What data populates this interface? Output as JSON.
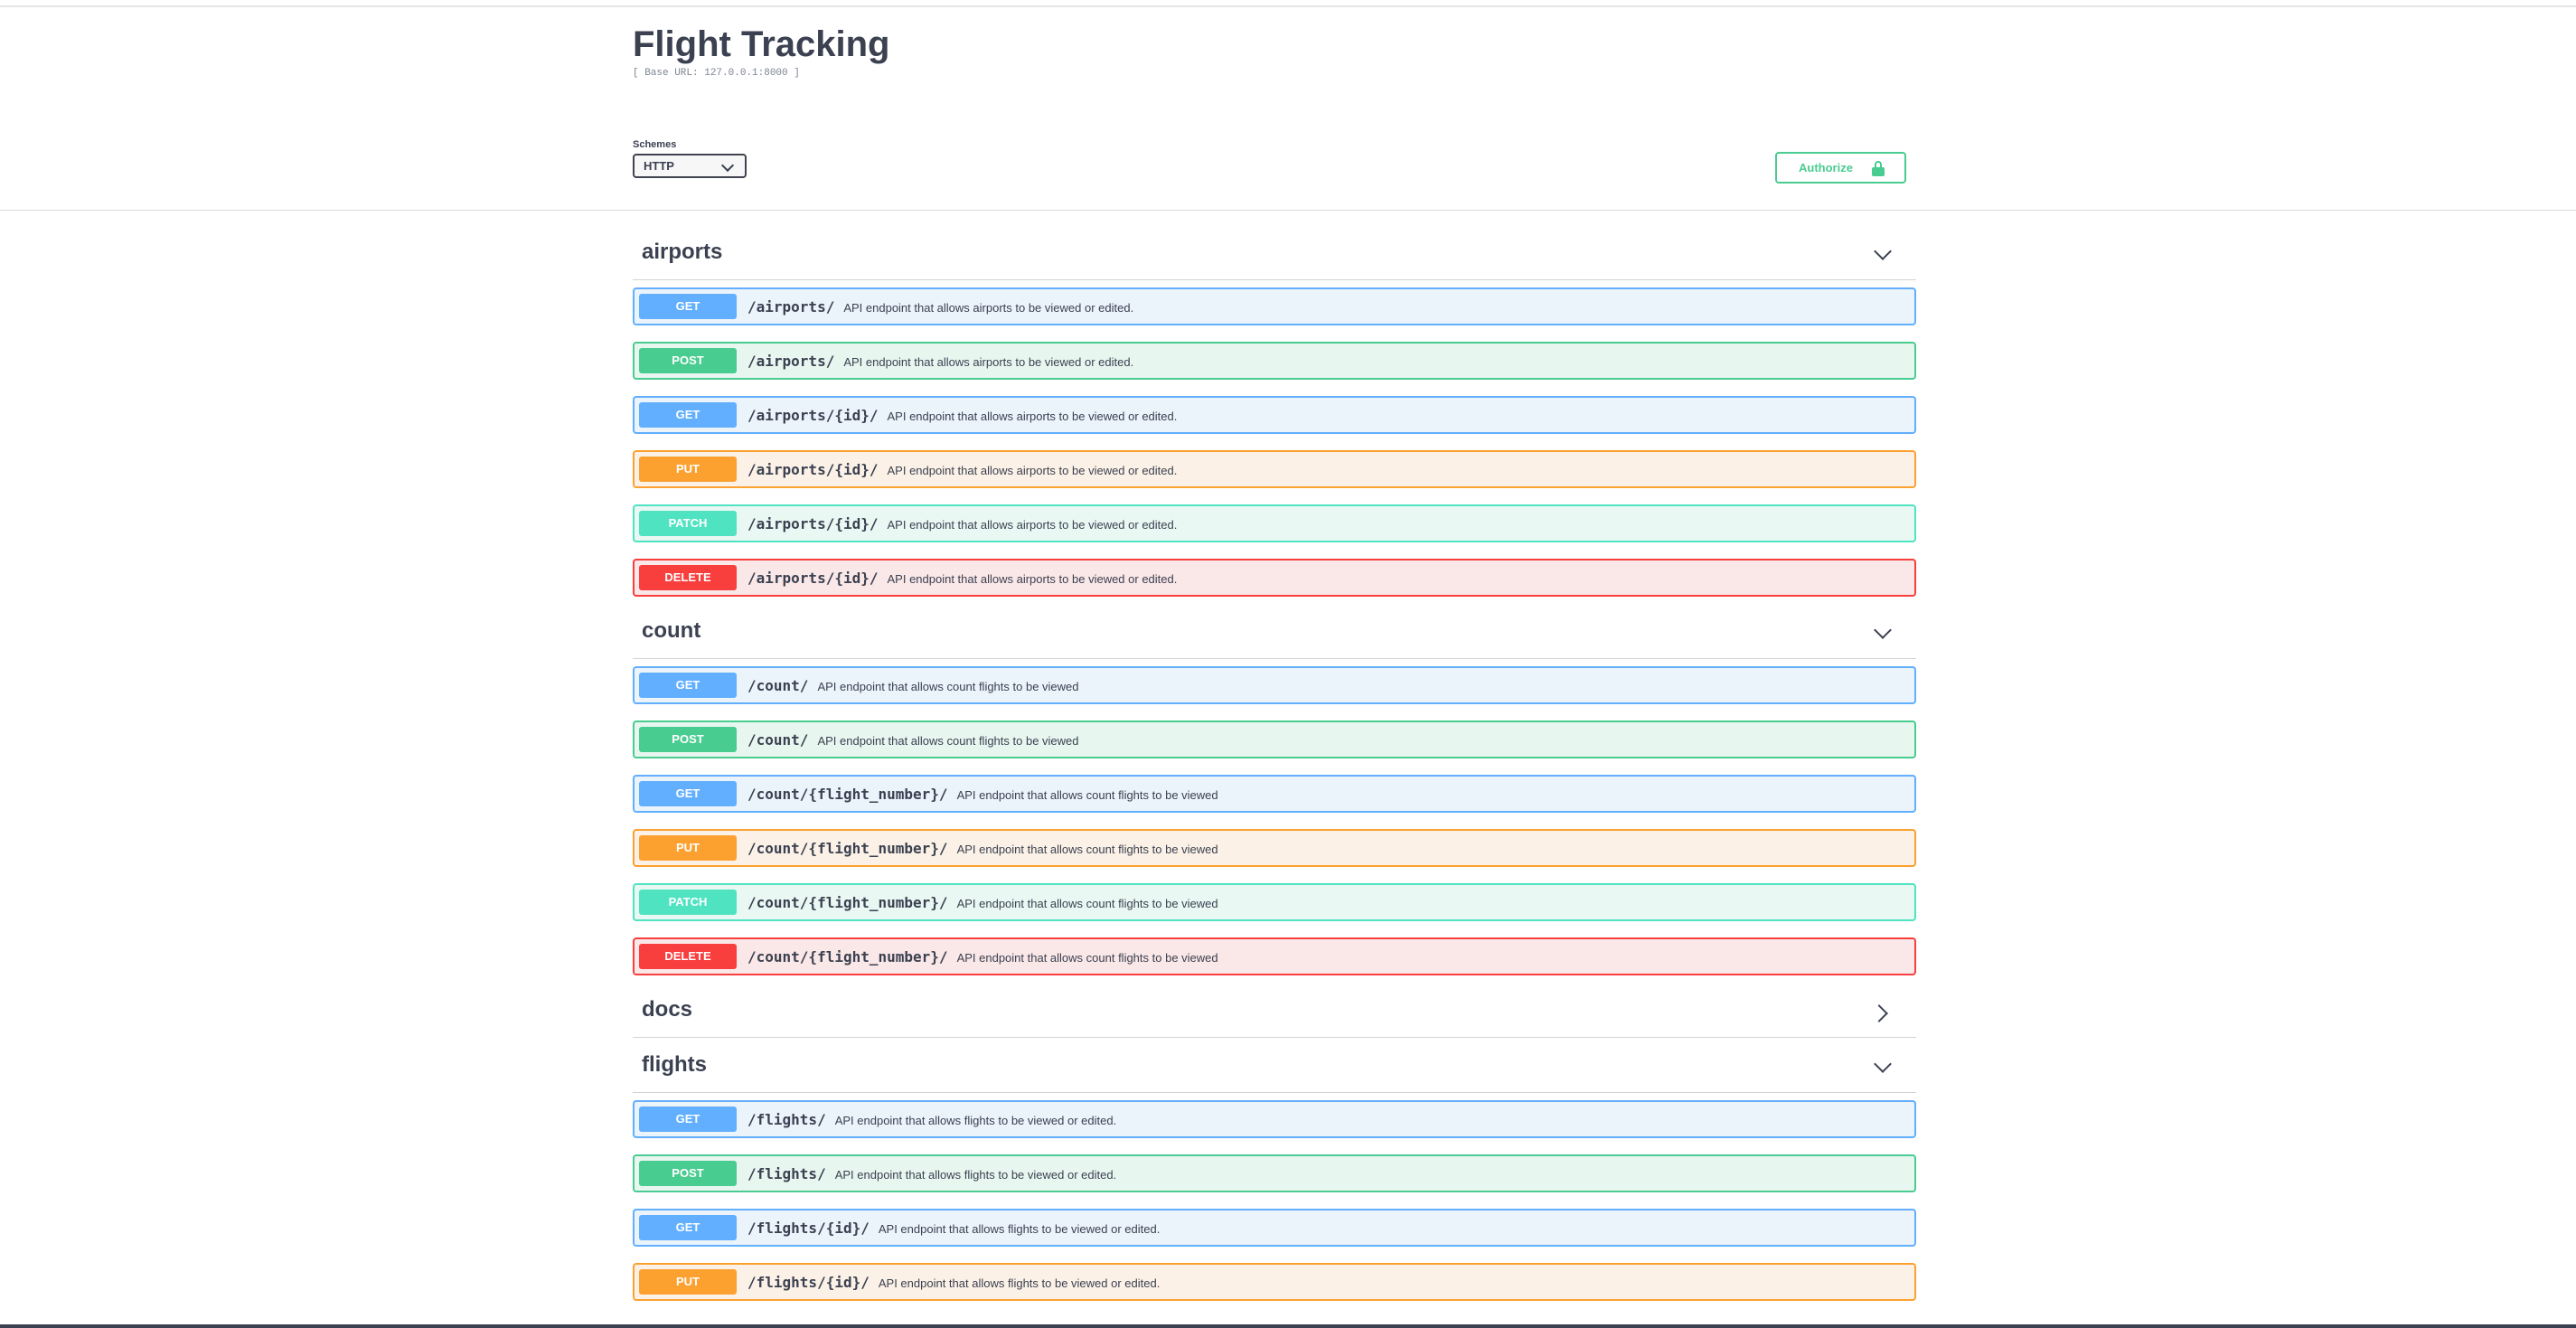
{
  "header": {
    "title": "Flight Tracking",
    "base_url": "[ Base URL: 127.0.0.1:8000 ]",
    "schemes_label": "Schemes",
    "scheme_selected": "HTTP",
    "authorize_label": "Authorize"
  },
  "colors": {
    "get": "#61affe",
    "post": "#49cc90",
    "put": "#fca130",
    "patch": "#50e3c2",
    "delete": "#f93e3e"
  },
  "tags": [
    {
      "name": "airports",
      "expanded": true,
      "operations": [
        {
          "method": "GET",
          "path": "/airports/",
          "description": "API endpoint that allows airports to be viewed or edited."
        },
        {
          "method": "POST",
          "path": "/airports/",
          "description": "API endpoint that allows airports to be viewed or edited."
        },
        {
          "method": "GET",
          "path": "/airports/{id}/",
          "description": "API endpoint that allows airports to be viewed or edited."
        },
        {
          "method": "PUT",
          "path": "/airports/{id}/",
          "description": "API endpoint that allows airports to be viewed or edited."
        },
        {
          "method": "PATCH",
          "path": "/airports/{id}/",
          "description": "API endpoint that allows airports to be viewed or edited."
        },
        {
          "method": "DELETE",
          "path": "/airports/{id}/",
          "description": "API endpoint that allows airports to be viewed or edited."
        }
      ]
    },
    {
      "name": "count",
      "expanded": true,
      "operations": [
        {
          "method": "GET",
          "path": "/count/",
          "description": "API endpoint that allows count flights to be viewed"
        },
        {
          "method": "POST",
          "path": "/count/",
          "description": "API endpoint that allows count flights to be viewed"
        },
        {
          "method": "GET",
          "path": "/count/{flight_number}/",
          "description": "API endpoint that allows count flights to be viewed"
        },
        {
          "method": "PUT",
          "path": "/count/{flight_number}/",
          "description": "API endpoint that allows count flights to be viewed"
        },
        {
          "method": "PATCH",
          "path": "/count/{flight_number}/",
          "description": "API endpoint that allows count flights to be viewed"
        },
        {
          "method": "DELETE",
          "path": "/count/{flight_number}/",
          "description": "API endpoint that allows count flights to be viewed"
        }
      ]
    },
    {
      "name": "docs",
      "expanded": false,
      "operations": []
    },
    {
      "name": "flights",
      "expanded": true,
      "operations": [
        {
          "method": "GET",
          "path": "/flights/",
          "description": "API endpoint that allows flights to be viewed or edited."
        },
        {
          "method": "POST",
          "path": "/flights/",
          "description": "API endpoint that allows flights to be viewed or edited."
        },
        {
          "method": "GET",
          "path": "/flights/{id}/",
          "description": "API endpoint that allows flights to be viewed or edited."
        },
        {
          "method": "PUT",
          "path": "/flights/{id}/",
          "description": "API endpoint that allows flights to be viewed or edited."
        }
      ]
    }
  ]
}
